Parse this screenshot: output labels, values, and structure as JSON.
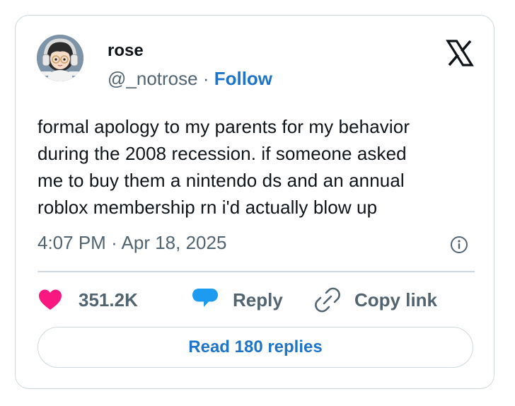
{
  "author": {
    "name": "rose",
    "handle": "@_notrose",
    "separator": "·",
    "follow_label": "Follow"
  },
  "tweet": {
    "lines": [
      "formal apology to my parents for my behavior",
      "during the 2008 recession. if someone asked",
      "me to buy them a nintendo ds and an annual",
      "roblox membership rn i'd actually blow up"
    ],
    "time": "4:07 PM",
    "separator": "·",
    "date": "Apr 18, 2025"
  },
  "actions": {
    "like_count": "351.2K",
    "reply_label": "Reply",
    "copy_link_label": "Copy link"
  },
  "read_replies_label": "Read 180 replies",
  "icons": {
    "brand": "x-logo-icon",
    "info": "info-icon",
    "like": "heart-icon",
    "reply": "speech-bubble-icon",
    "copy": "link-icon"
  },
  "colors": {
    "heart": "#f91880",
    "reply_bubble": "#1d9bf0",
    "link_blue": "#1d74c8",
    "secondary_text": "#536471",
    "border": "#cfd9de"
  }
}
